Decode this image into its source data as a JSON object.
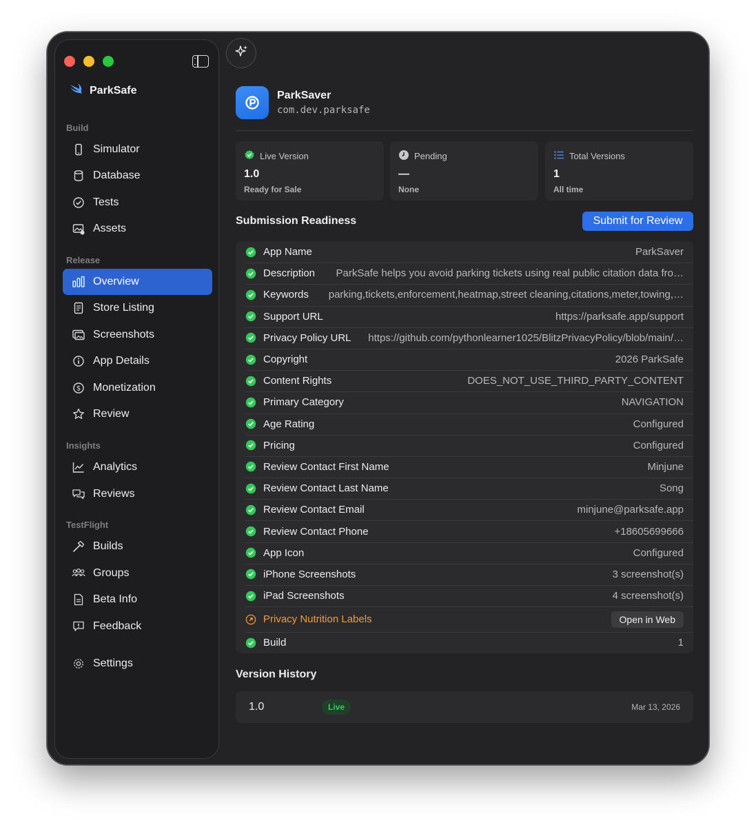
{
  "sidebar": {
    "brand": "ParkSafe",
    "sections": [
      {
        "label": "Build",
        "items": [
          {
            "label": "Simulator",
            "icon": "phone-icon"
          },
          {
            "label": "Database",
            "icon": "database-icon"
          },
          {
            "label": "Tests",
            "icon": "checkmark-circle-icon"
          },
          {
            "label": "Assets",
            "icon": "photo-icon"
          }
        ]
      },
      {
        "label": "Release",
        "items": [
          {
            "label": "Overview",
            "icon": "bar-chart-icon",
            "active": true
          },
          {
            "label": "Store Listing",
            "icon": "document-icon"
          },
          {
            "label": "Screenshots",
            "icon": "screenshots-icon"
          },
          {
            "label": "App Details",
            "icon": "info-icon"
          },
          {
            "label": "Monetization",
            "icon": "dollar-circle-icon"
          },
          {
            "label": "Review",
            "icon": "star-icon"
          }
        ]
      },
      {
        "label": "Insights",
        "items": [
          {
            "label": "Analytics",
            "icon": "line-chart-icon"
          },
          {
            "label": "Reviews",
            "icon": "chat-bubbles-icon"
          }
        ]
      },
      {
        "label": "TestFlight",
        "items": [
          {
            "label": "Builds",
            "icon": "hammer-icon"
          },
          {
            "label": "Groups",
            "icon": "people-icon"
          },
          {
            "label": "Beta Info",
            "icon": "document-text-icon"
          },
          {
            "label": "Feedback",
            "icon": "exclamation-bubble-icon"
          }
        ]
      }
    ],
    "settings": {
      "label": "Settings",
      "icon": "gear-icon"
    }
  },
  "app": {
    "name": "ParkSaver",
    "bundle_id": "com.dev.parksafe"
  },
  "stats": [
    {
      "title": "Live Version",
      "value": "1.0",
      "sub": "Ready for Sale",
      "icon": "verified-badge-icon"
    },
    {
      "title": "Pending",
      "value": "—",
      "sub": "None",
      "icon": "clock-icon"
    },
    {
      "title": "Total Versions",
      "value": "1",
      "sub": "All time",
      "icon": "list-icon"
    }
  ],
  "readiness": {
    "title": "Submission Readiness",
    "submit_label": "Submit for Review",
    "rows": [
      {
        "label": "App Name",
        "value": "ParkSaver",
        "status": "ok"
      },
      {
        "label": "Description",
        "value": "ParkSafe helps you avoid parking tickets using real public citation data fro…",
        "status": "ok"
      },
      {
        "label": "Keywords",
        "value": "parking,tickets,enforcement,heatmap,street cleaning,citations,meter,towing,…",
        "status": "ok"
      },
      {
        "label": "Support URL",
        "value": "https://parksafe.app/support",
        "status": "ok"
      },
      {
        "label": "Privacy Policy URL",
        "value": "https://github.com/pythonlearner1025/BlitzPrivacyPolicy/blob/main/…",
        "status": "ok"
      },
      {
        "label": "Copyright",
        "value": "2026 ParkSafe",
        "status": "ok"
      },
      {
        "label": "Content Rights",
        "value": "DOES_NOT_USE_THIRD_PARTY_CONTENT",
        "status": "ok"
      },
      {
        "label": "Primary Category",
        "value": "NAVIGATION",
        "status": "ok"
      },
      {
        "label": "Age Rating",
        "value": "Configured",
        "status": "ok"
      },
      {
        "label": "Pricing",
        "value": "Configured",
        "status": "ok"
      },
      {
        "label": "Review Contact First Name",
        "value": "Minjune",
        "status": "ok"
      },
      {
        "label": "Review Contact Last Name",
        "value": "Song",
        "status": "ok"
      },
      {
        "label": "Review Contact Email",
        "value": "minjune@parksafe.app",
        "status": "ok"
      },
      {
        "label": "Review Contact Phone",
        "value": "+18605699666",
        "status": "ok"
      },
      {
        "label": "App Icon",
        "value": "Configured",
        "status": "ok"
      },
      {
        "label": "iPhone Screenshots",
        "value": "3 screenshot(s)",
        "status": "ok"
      },
      {
        "label": "iPad Screenshots",
        "value": "4 screenshot(s)",
        "status": "ok"
      },
      {
        "label": "Privacy Nutrition Labels",
        "value": "",
        "status": "warn",
        "action": "Open in Web"
      },
      {
        "label": "Build",
        "value": "1",
        "status": "ok"
      }
    ]
  },
  "history": {
    "title": "Version History",
    "entries": [
      {
        "version": "1.0",
        "badge": "Live",
        "date": "Mar 13, 2026"
      }
    ]
  },
  "colors": {
    "accent": "#2d6fe8",
    "ok": "#34c759",
    "warn": "#f39a3a",
    "window_bg": "#232325",
    "sidebar_bg": "#1d1d1f"
  }
}
